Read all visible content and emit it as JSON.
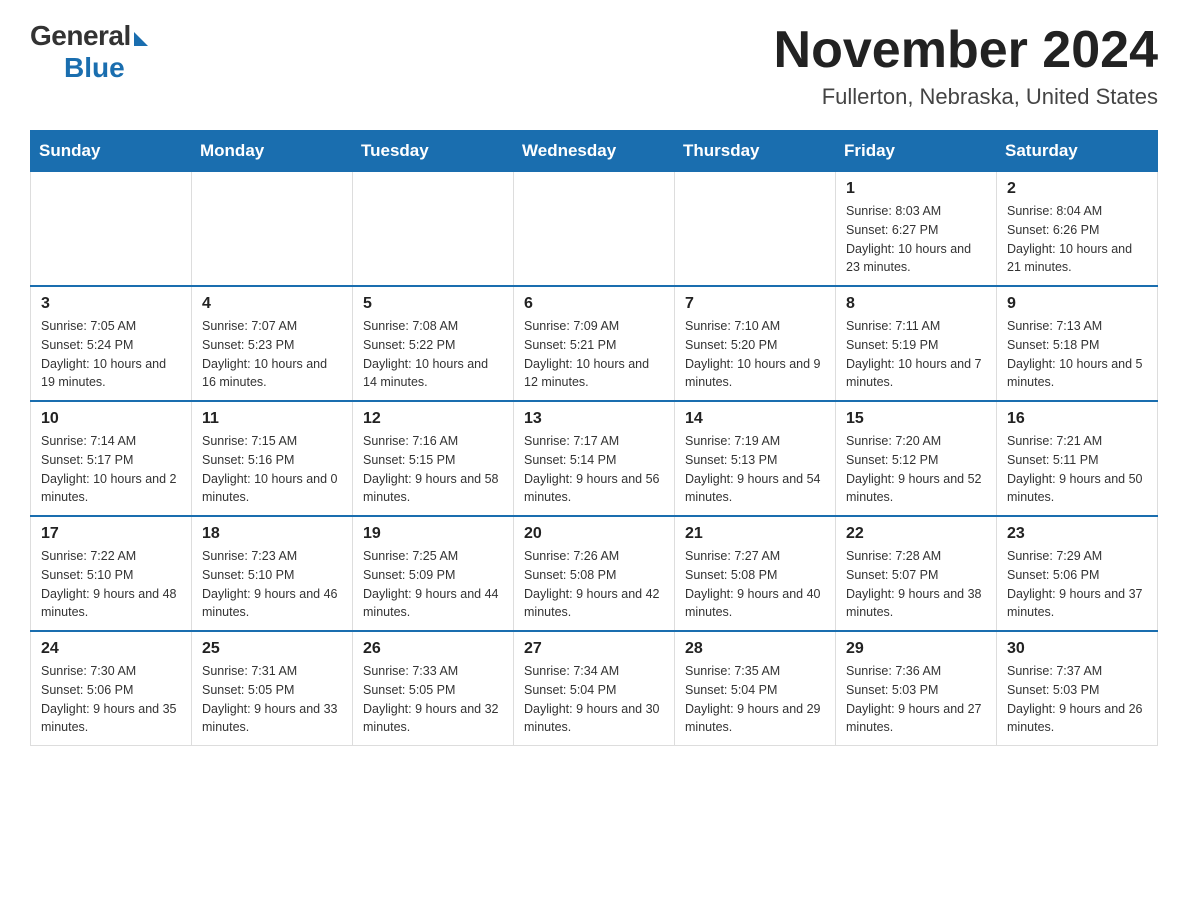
{
  "header": {
    "logo_general": "General",
    "logo_blue": "Blue",
    "month_title": "November 2024",
    "location": "Fullerton, Nebraska, United States"
  },
  "days_of_week": [
    "Sunday",
    "Monday",
    "Tuesday",
    "Wednesday",
    "Thursday",
    "Friday",
    "Saturday"
  ],
  "weeks": [
    [
      {
        "day": "",
        "info": ""
      },
      {
        "day": "",
        "info": ""
      },
      {
        "day": "",
        "info": ""
      },
      {
        "day": "",
        "info": ""
      },
      {
        "day": "",
        "info": ""
      },
      {
        "day": "1",
        "info": "Sunrise: 8:03 AM\nSunset: 6:27 PM\nDaylight: 10 hours and 23 minutes."
      },
      {
        "day": "2",
        "info": "Sunrise: 8:04 AM\nSunset: 6:26 PM\nDaylight: 10 hours and 21 minutes."
      }
    ],
    [
      {
        "day": "3",
        "info": "Sunrise: 7:05 AM\nSunset: 5:24 PM\nDaylight: 10 hours and 19 minutes."
      },
      {
        "day": "4",
        "info": "Sunrise: 7:07 AM\nSunset: 5:23 PM\nDaylight: 10 hours and 16 minutes."
      },
      {
        "day": "5",
        "info": "Sunrise: 7:08 AM\nSunset: 5:22 PM\nDaylight: 10 hours and 14 minutes."
      },
      {
        "day": "6",
        "info": "Sunrise: 7:09 AM\nSunset: 5:21 PM\nDaylight: 10 hours and 12 minutes."
      },
      {
        "day": "7",
        "info": "Sunrise: 7:10 AM\nSunset: 5:20 PM\nDaylight: 10 hours and 9 minutes."
      },
      {
        "day": "8",
        "info": "Sunrise: 7:11 AM\nSunset: 5:19 PM\nDaylight: 10 hours and 7 minutes."
      },
      {
        "day": "9",
        "info": "Sunrise: 7:13 AM\nSunset: 5:18 PM\nDaylight: 10 hours and 5 minutes."
      }
    ],
    [
      {
        "day": "10",
        "info": "Sunrise: 7:14 AM\nSunset: 5:17 PM\nDaylight: 10 hours and 2 minutes."
      },
      {
        "day": "11",
        "info": "Sunrise: 7:15 AM\nSunset: 5:16 PM\nDaylight: 10 hours and 0 minutes."
      },
      {
        "day": "12",
        "info": "Sunrise: 7:16 AM\nSunset: 5:15 PM\nDaylight: 9 hours and 58 minutes."
      },
      {
        "day": "13",
        "info": "Sunrise: 7:17 AM\nSunset: 5:14 PM\nDaylight: 9 hours and 56 minutes."
      },
      {
        "day": "14",
        "info": "Sunrise: 7:19 AM\nSunset: 5:13 PM\nDaylight: 9 hours and 54 minutes."
      },
      {
        "day": "15",
        "info": "Sunrise: 7:20 AM\nSunset: 5:12 PM\nDaylight: 9 hours and 52 minutes."
      },
      {
        "day": "16",
        "info": "Sunrise: 7:21 AM\nSunset: 5:11 PM\nDaylight: 9 hours and 50 minutes."
      }
    ],
    [
      {
        "day": "17",
        "info": "Sunrise: 7:22 AM\nSunset: 5:10 PM\nDaylight: 9 hours and 48 minutes."
      },
      {
        "day": "18",
        "info": "Sunrise: 7:23 AM\nSunset: 5:10 PM\nDaylight: 9 hours and 46 minutes."
      },
      {
        "day": "19",
        "info": "Sunrise: 7:25 AM\nSunset: 5:09 PM\nDaylight: 9 hours and 44 minutes."
      },
      {
        "day": "20",
        "info": "Sunrise: 7:26 AM\nSunset: 5:08 PM\nDaylight: 9 hours and 42 minutes."
      },
      {
        "day": "21",
        "info": "Sunrise: 7:27 AM\nSunset: 5:08 PM\nDaylight: 9 hours and 40 minutes."
      },
      {
        "day": "22",
        "info": "Sunrise: 7:28 AM\nSunset: 5:07 PM\nDaylight: 9 hours and 38 minutes."
      },
      {
        "day": "23",
        "info": "Sunrise: 7:29 AM\nSunset: 5:06 PM\nDaylight: 9 hours and 37 minutes."
      }
    ],
    [
      {
        "day": "24",
        "info": "Sunrise: 7:30 AM\nSunset: 5:06 PM\nDaylight: 9 hours and 35 minutes."
      },
      {
        "day": "25",
        "info": "Sunrise: 7:31 AM\nSunset: 5:05 PM\nDaylight: 9 hours and 33 minutes."
      },
      {
        "day": "26",
        "info": "Sunrise: 7:33 AM\nSunset: 5:05 PM\nDaylight: 9 hours and 32 minutes."
      },
      {
        "day": "27",
        "info": "Sunrise: 7:34 AM\nSunset: 5:04 PM\nDaylight: 9 hours and 30 minutes."
      },
      {
        "day": "28",
        "info": "Sunrise: 7:35 AM\nSunset: 5:04 PM\nDaylight: 9 hours and 29 minutes."
      },
      {
        "day": "29",
        "info": "Sunrise: 7:36 AM\nSunset: 5:03 PM\nDaylight: 9 hours and 27 minutes."
      },
      {
        "day": "30",
        "info": "Sunrise: 7:37 AM\nSunset: 5:03 PM\nDaylight: 9 hours and 26 minutes."
      }
    ]
  ]
}
